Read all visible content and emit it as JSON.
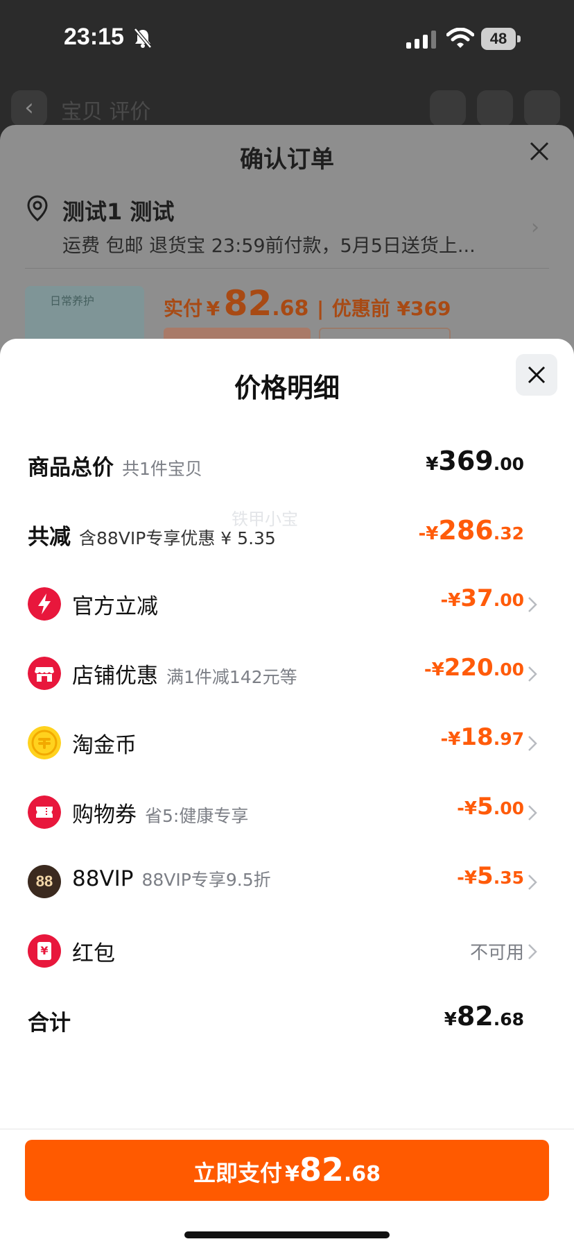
{
  "status_bar": {
    "time": "23:15",
    "battery": "48",
    "icons": [
      "bell-muted-icon",
      "signal-icon",
      "wifi-icon",
      "battery-icon"
    ]
  },
  "background_page": {
    "nav_tabs": "宝贝  评价",
    "icons": [
      "back-icon",
      "share-icon",
      "cart-icon",
      "more-icon"
    ]
  },
  "order_sheet": {
    "title": "确认订单",
    "address_name": "测试1 测试",
    "shipping_line": "运费 包邮 退货宝 23:59前付款，5月5日送货上...",
    "product_thumb_label": "日常养护",
    "paid_label": "实付",
    "paid_currency": "¥",
    "paid_int": "82",
    "paid_dec": ".68",
    "paid_separator": "|",
    "before_discount": "优惠前 ¥369"
  },
  "price_detail": {
    "title": "价格明细",
    "watermark": "铁甲小宝",
    "rows": [
      {
        "label": "商品总价",
        "sub": "共1件宝贝",
        "amount_cur": "¥",
        "amount_int": "369",
        "amount_dec": ".00",
        "color": "#111111"
      },
      {
        "label": "共减",
        "sub": "含88VIP专享优惠 ¥ 5.35",
        "amount_cur": "-¥",
        "amount_int": "286",
        "amount_dec": ".32",
        "color": "#ff5b0a"
      },
      {
        "label": "官方立减",
        "sub": "",
        "icon": "lightning-icon",
        "amount_cur": "-¥",
        "amount_int": "37",
        "amount_dec": ".00",
        "color": "#ff5b0a"
      },
      {
        "label": "店铺优惠",
        "sub": "满1件减142元等",
        "icon": "shop-icon",
        "amount_cur": "-¥",
        "amount_int": "220",
        "amount_dec": ".00",
        "color": "#ff5b0a"
      },
      {
        "label": "淘金币",
        "sub": "",
        "icon": "gold-coin-icon",
        "amount_cur": "-¥",
        "amount_int": "18",
        "amount_dec": ".97",
        "color": "#ff5b0a"
      },
      {
        "label": "购物券",
        "sub": "省5:健康专享",
        "icon": "coupon-icon",
        "amount_cur": "-¥",
        "amount_int": "5",
        "amount_dec": ".00",
        "color": "#ff5b0a"
      },
      {
        "label": "88VIP",
        "sub": "88VIP专享9.5折",
        "icon": "vip88-icon",
        "icon_text": "88",
        "amount_cur": "-¥",
        "amount_int": "5",
        "amount_dec": ".35",
        "color": "#ff5b0a"
      },
      {
        "label": "红包",
        "sub": "",
        "icon": "red-packet-icon",
        "icon_text": "¥",
        "status": "不可用"
      },
      {
        "label": "合计",
        "sub": "",
        "amount_cur": "¥",
        "amount_int": "82",
        "amount_dec": ".68",
        "color": "#111111"
      }
    ]
  },
  "pay_button": {
    "label": "立即支付",
    "currency": "¥",
    "int": "82",
    "dec": ".68"
  },
  "colors": {
    "accent": "#ff5a00",
    "discount": "#ff5b0a",
    "icon_red": "#e8173c",
    "coin_yellow": "#ffd21e",
    "vip_dark": "#3b2a1f"
  }
}
